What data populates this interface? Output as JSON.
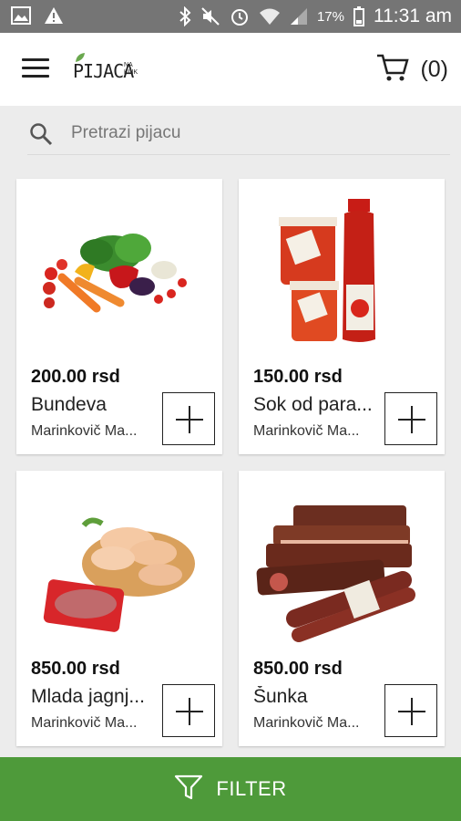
{
  "status_bar": {
    "icons_left": [
      "gallery-icon",
      "warning-icon"
    ],
    "icons_right": [
      "bluetooth-icon",
      "mute-icon",
      "alarm-icon",
      "wifi-icon",
      "signal-icon",
      "battery-icon"
    ],
    "battery": "17%",
    "time": "11:31 am"
  },
  "header": {
    "logo_main": "PIJACA",
    "logo_small_1": "NA",
    "logo_small_2": "KLIK",
    "cart_count": "(0)"
  },
  "search": {
    "placeholder": "Pretrazi pijacu"
  },
  "products": [
    {
      "price": "200.00 rsd",
      "name": "Bundeva",
      "seller": "Marinkovič Ma...",
      "image": "vegetables-image"
    },
    {
      "price": "150.00 rsd",
      "name": "Sok od para...",
      "seller": "Marinkovič Ma...",
      "image": "tomato-juice-image"
    },
    {
      "price": "850.00 rsd",
      "name": "Mlada jagnj...",
      "seller": "Marinkovič Ma...",
      "image": "chicken-meat-image"
    },
    {
      "price": "850.00 rsd",
      "name": "Šunka",
      "seller": "Marinkovič Ma...",
      "image": "ham-sausage-image"
    }
  ],
  "filter_bar": {
    "label": "FILTER",
    "color": "#4e9a3a"
  }
}
